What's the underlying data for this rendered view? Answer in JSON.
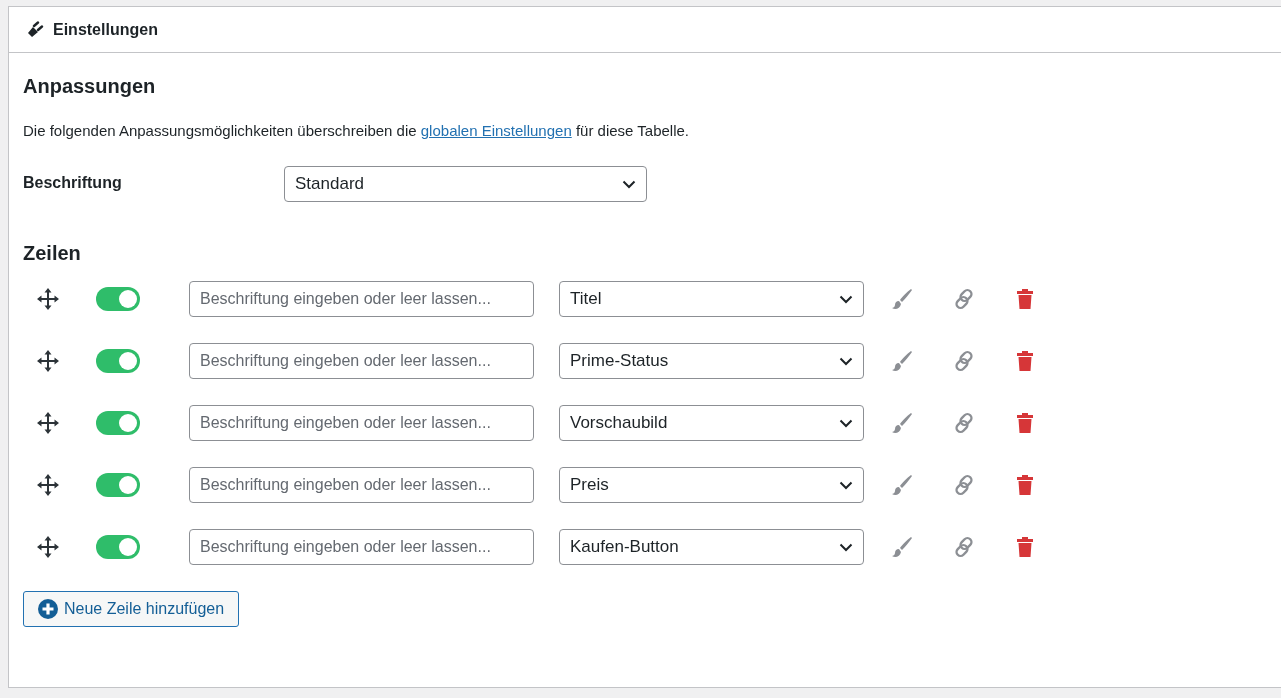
{
  "panel": {
    "title": "Einstellungen"
  },
  "section_title": "Anpassungen",
  "description": {
    "before": "Die folgenden Anpassungsmöglichkeiten überschreiben die",
    "link": "globalen Einstellungen",
    "after": "für diese Tabelle."
  },
  "caption": {
    "label": "Beschriftung",
    "value": "Standard"
  },
  "rows_title": "Zeilen",
  "rows": [
    {
      "on": true,
      "placeholder": "Beschriftung eingeben oder leer lassen...",
      "field": "Titel"
    },
    {
      "on": true,
      "placeholder": "Beschriftung eingeben oder leer lassen...",
      "field": "Prime-Status"
    },
    {
      "on": true,
      "placeholder": "Beschriftung eingeben oder leer lassen...",
      "field": "Vorschaubild"
    },
    {
      "on": true,
      "placeholder": "Beschriftung eingeben oder leer lassen...",
      "field": "Preis"
    },
    {
      "on": true,
      "placeholder": "Beschriftung eingeben oder leer lassen...",
      "field": "Kaufen-Button"
    }
  ],
  "add_button": "Neue Zeile hinzufügen"
}
